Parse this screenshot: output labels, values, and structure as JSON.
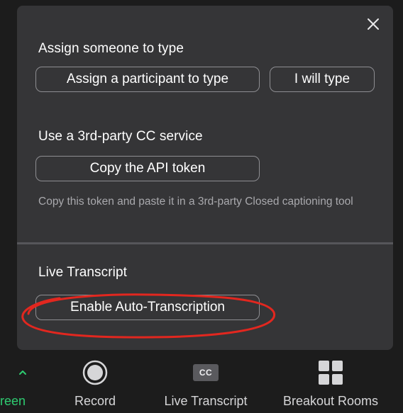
{
  "popup": {
    "assign_section": {
      "title": "Assign someone to type",
      "assign_participant_label": "Assign a participant to type",
      "i_will_type_label": "I will type"
    },
    "cc_section": {
      "title": "Use a 3rd-party CC service",
      "copy_token_label": "Copy the API token",
      "hint": "Copy this token and paste it in a 3rd-party Closed captioning tool"
    },
    "live_section": {
      "title": "Live Transcript",
      "enable_label": "Enable Auto-Transcription"
    },
    "highlight_color": "#e2271f"
  },
  "toolbar": {
    "share_partial_label": "reen",
    "share_chevron_color": "#2ecc71",
    "record_label": "Record",
    "live_transcript_label": "Live Transcript",
    "cc_icon_text": "CC",
    "breakout_label": "Breakout Rooms"
  },
  "icons": {
    "close": "close-icon",
    "chevron": "chevron-up-icon",
    "record": "record-icon",
    "cc": "cc-icon",
    "breakout": "grid-icon"
  }
}
